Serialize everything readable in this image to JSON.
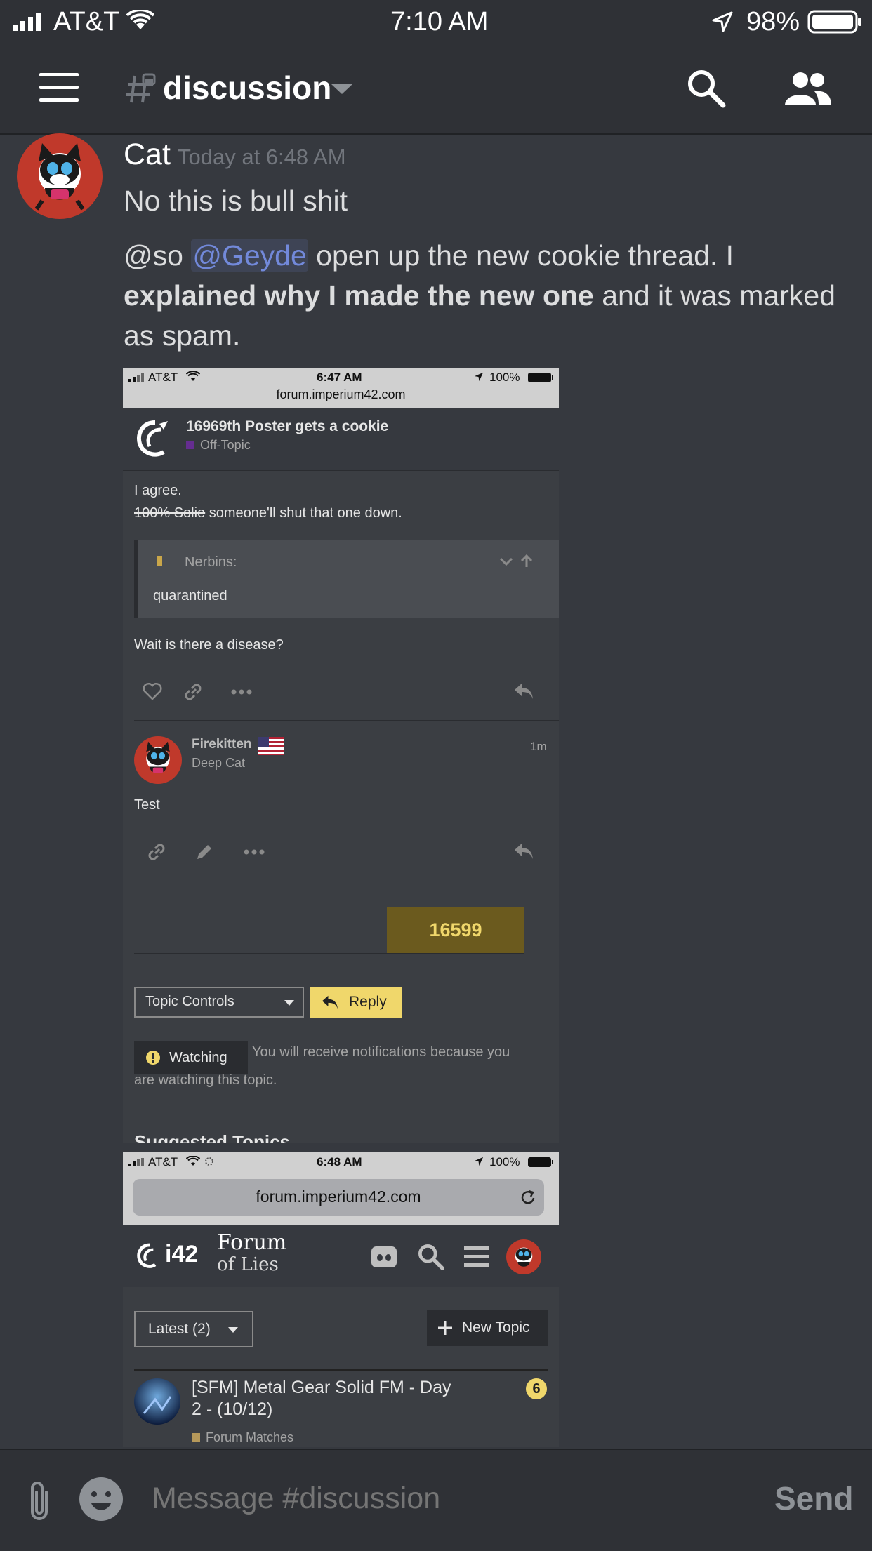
{
  "status_bar": {
    "carrier": "AT&T",
    "time": "7:10 AM",
    "battery": "98%"
  },
  "header": {
    "channel": "discussion"
  },
  "message": {
    "author": "Cat",
    "timestamp": "Today at 6:48 AM",
    "line1": "No this is bull shit",
    "line2_prefix": "@so ",
    "mention": "@Geyde",
    "line2_after_mention": " open up the new cookie thread. I",
    "line3_bold": "explained why I made the new one",
    "line3_rest": " and it was marked",
    "line4": "as spam."
  },
  "shot1": {
    "status_carrier": "AT&T",
    "status_time": "6:47 AM",
    "status_battery": "100%",
    "url": "forum.imperium42.com",
    "topic_title": "16969th Poster gets a cookie",
    "category": "Off-Topic",
    "post1_line1": "I agree.",
    "post1_strike": "100% Solie",
    "post1_rest": " someone'll shut that one down.",
    "quote_author": "Nerbins:",
    "quote_text": "quarantined",
    "post1_line3": "Wait is there a disease?",
    "post2_author": "Firekitten",
    "post2_title": "Deep Cat",
    "post2_age": "1m",
    "post2_text": "Test",
    "post_count": "16599",
    "topic_controls": "Topic Controls",
    "reply": "Reply",
    "watching": "Watching",
    "watching_note_1": "You will receive notifications because you",
    "watching_note_2": "are watching this topic.",
    "suggested_cut": "Suggested Topics"
  },
  "shot2": {
    "status_carrier": "AT&T",
    "status_time": "6:48 AM",
    "status_battery": "100%",
    "url": "forum.imperium42.com",
    "logo_i42": "i42",
    "logo_forum": "Forum",
    "logo_lies": "of Lies",
    "latest": "Latest (2)",
    "new_topic": "New Topic",
    "topic_title_1": "[SFM] Metal Gear Solid FM - Day",
    "topic_title_2": "2 - (10/12)",
    "topic_badge": "6",
    "topic_category": "Forum Matches"
  },
  "composer": {
    "placeholder": "Message #discussion",
    "send": "Send"
  },
  "colors": {
    "mention": "#7289da",
    "post_count_bg": "#6b5a1e",
    "reply_bg": "#f0d76b"
  }
}
